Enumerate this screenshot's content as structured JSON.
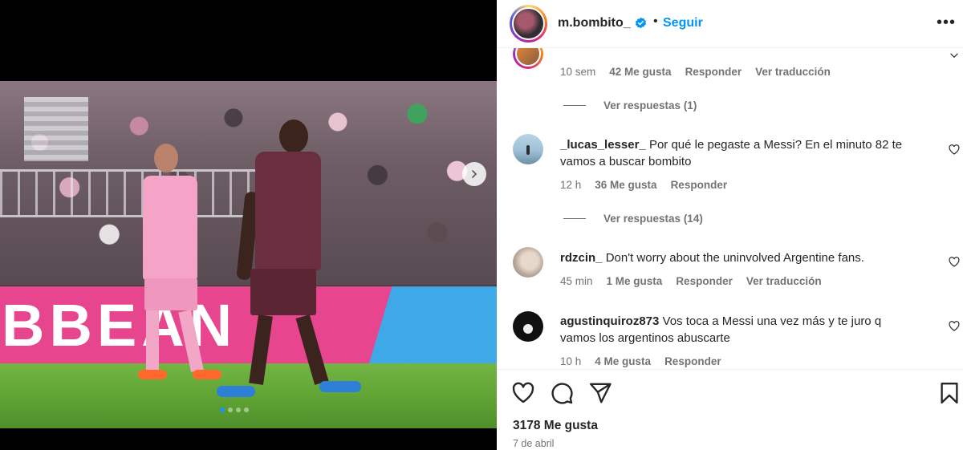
{
  "post": {
    "username": "m.bombito_",
    "separator": "•",
    "follow_label": "Seguir",
    "more_label": "•••",
    "likes": "3178 Me gusta",
    "date": "7 de abril",
    "carousel": {
      "total_slides": 4,
      "active_slide": 1
    }
  },
  "board": {
    "text": "BBEAN"
  },
  "comments": [
    {
      "username": "",
      "text": "",
      "time": "10 sem",
      "likes": "42 Me gusta",
      "reply_label": "Responder",
      "translate_label": "Ver traducción",
      "replies_label": "Ver respuestas (1)"
    },
    {
      "username": "_lucas_lesser_",
      "text": "Por qué le pegaste a Messi? En el minuto 82 te vamos a buscar bombito",
      "time": "12 h",
      "likes": "36 Me gusta",
      "reply_label": "Responder",
      "replies_label": "Ver respuestas (14)"
    },
    {
      "username": "rdzcin_",
      "text": "Don't worry about the uninvolved Argentine fans.",
      "time": "45 min",
      "likes": "1 Me gusta",
      "reply_label": "Responder",
      "translate_label": "Ver traducción"
    },
    {
      "username": "agustinquiroz873",
      "text": "Vos toca a Messi una vez más y te juro q vamos los argentinos abuscarte",
      "time": "10 h",
      "likes": "4 Me gusta",
      "reply_label": "Responder"
    }
  ],
  "colors": {
    "link_blue": "#0095f6",
    "verified_blue": "#0095f6",
    "text_primary": "#262626",
    "text_secondary": "#737373",
    "board_pink": "#e8458f",
    "board_blue": "#3fa9e8"
  },
  "icons": {
    "verified": "verified-badge-icon",
    "like": "heart-icon",
    "comment": "comment-bubble-icon",
    "share": "paper-plane-icon",
    "save": "bookmark-icon",
    "next": "chevron-right-icon",
    "comment_like": "small-heart-icon"
  }
}
